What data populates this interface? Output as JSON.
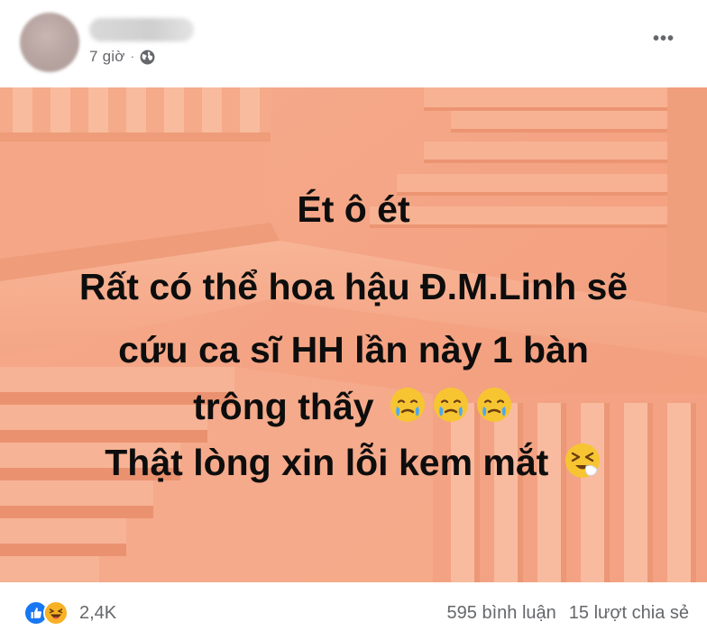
{
  "post": {
    "author_name": "",
    "time": "7 giờ",
    "separator": "·",
    "privacy_icon": "globe-icon",
    "more_label": "•••"
  },
  "content": {
    "background_color": "#f3a687",
    "lines": [
      "Ét ô ét",
      "Rất có thể hoa hậu Đ.M.Linh sẽ",
      "cứu ca sĩ HH lần này 1 bàn",
      "trông thấy",
      "Thật lòng xin lỗi kem mắt"
    ],
    "emojis": {
      "line4": [
        "crying-face-emoji",
        "crying-face-emoji",
        "crying-face-emoji"
      ],
      "line5": [
        "tired-face-emoji"
      ]
    }
  },
  "footer": {
    "reaction_icons": [
      "like-icon",
      "haha-icon"
    ],
    "reaction_count": "2,4K",
    "comments": "595 bình luận",
    "shares": "15 lượt chia sẻ"
  },
  "colors": {
    "meta_text": "#65676b",
    "like_blue": "#1877f2",
    "haha_yellow": "#f7b125"
  }
}
